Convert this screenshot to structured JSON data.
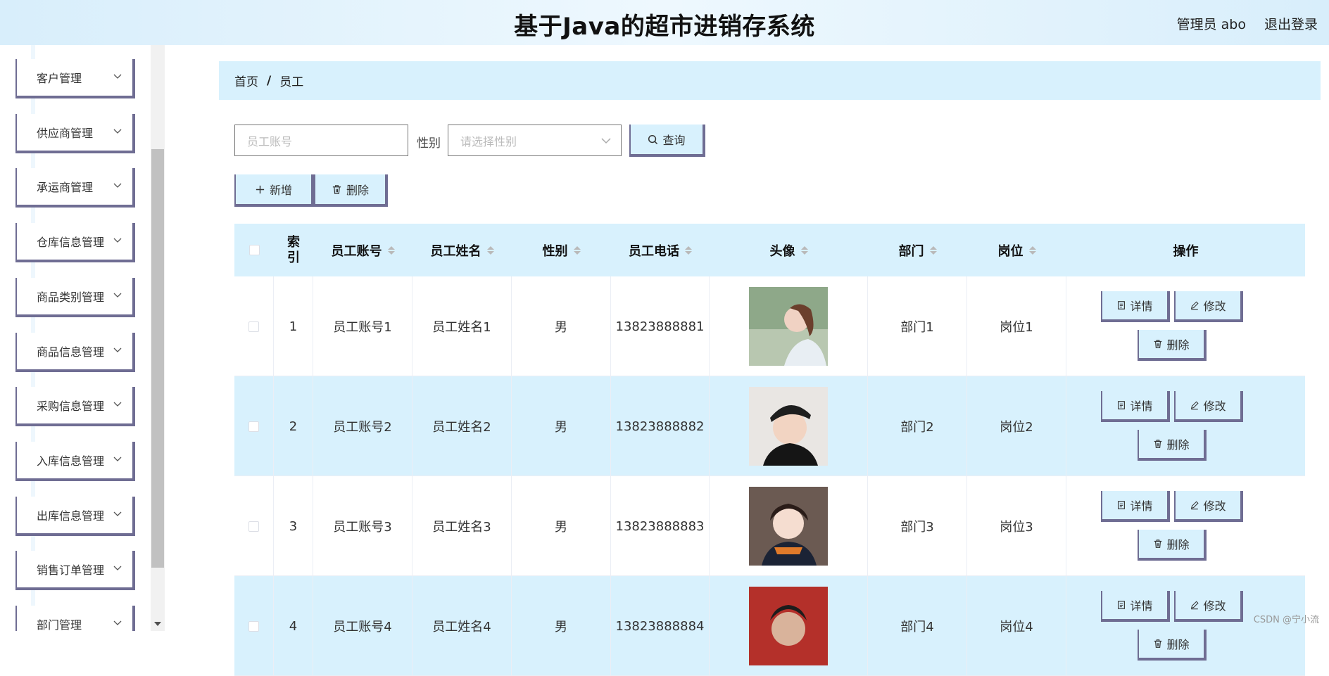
{
  "header": {
    "title": "基于Java的超市进销存系统",
    "user": "管理员 abo",
    "logout": "退出登录"
  },
  "sidebar": {
    "items": [
      {
        "label": "客户管理"
      },
      {
        "label": "供应商管理"
      },
      {
        "label": "承运商管理"
      },
      {
        "label": "仓库信息管理"
      },
      {
        "label": "商品类别管理"
      },
      {
        "label": "商品信息管理"
      },
      {
        "label": "采购信息管理"
      },
      {
        "label": "入库信息管理"
      },
      {
        "label": "出库信息管理"
      },
      {
        "label": "销售订单管理"
      },
      {
        "label": "部门管理"
      }
    ]
  },
  "breadcrumb": {
    "home": "首页",
    "separator": "/",
    "current": "员工"
  },
  "search": {
    "account_placeholder": "员工账号",
    "gender_label": "性别",
    "gender_placeholder": "请选择性别",
    "query_label": "查询"
  },
  "toolbar": {
    "add_label": "新增",
    "delete_label": "删除"
  },
  "table": {
    "columns": {
      "index": "索引",
      "account": "员工账号",
      "name": "员工姓名",
      "gender": "性别",
      "phone": "员工电话",
      "avatar": "头像",
      "dept": "部门",
      "post": "岗位",
      "ops": "操作"
    },
    "actions": {
      "detail": "详情",
      "edit": "修改",
      "delete": "删除"
    },
    "rows": [
      {
        "index": "1",
        "account": "员工账号1",
        "name": "员工姓名1",
        "gender": "男",
        "phone": "13823888881",
        "dept": "部门1",
        "post": "岗位1"
      },
      {
        "index": "2",
        "account": "员工账号2",
        "name": "员工姓名2",
        "gender": "男",
        "phone": "13823888882",
        "dept": "部门2",
        "post": "岗位2"
      },
      {
        "index": "3",
        "account": "员工账号3",
        "name": "员工姓名3",
        "gender": "男",
        "phone": "13823888883",
        "dept": "部门3",
        "post": "岗位3"
      },
      {
        "index": "4",
        "account": "员工账号4",
        "name": "员工姓名4",
        "gender": "男",
        "phone": "13823888884",
        "dept": "部门4",
        "post": "岗位4"
      }
    ]
  },
  "watermark": "CSDN @宁小流",
  "colors": {
    "accent_bg": "#d8f1fd",
    "button_border": "#6f6d93",
    "header_bg": "#e6f5fd"
  }
}
